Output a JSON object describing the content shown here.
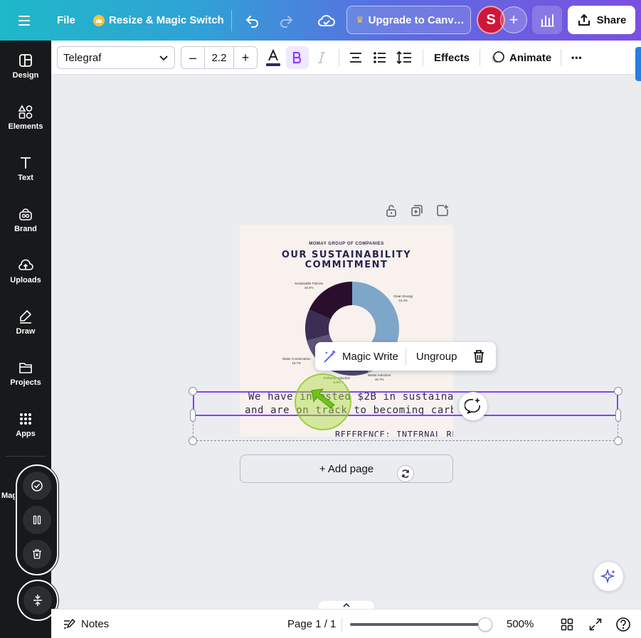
{
  "topbar": {
    "file_label": "File",
    "resize_label": "Resize & Magic Switch",
    "upgrade_label": "Upgrade to Canv…",
    "avatar_initial": "S",
    "share_label": "Share"
  },
  "sidebar": {
    "items": [
      {
        "label": "Design",
        "icon": "design-icon"
      },
      {
        "label": "Elements",
        "icon": "elements-icon"
      },
      {
        "label": "Text",
        "icon": "text-icon"
      },
      {
        "label": "Brand",
        "icon": "brand-icon"
      },
      {
        "label": "Uploads",
        "icon": "uploads-icon"
      },
      {
        "label": "Draw",
        "icon": "draw-icon"
      },
      {
        "label": "Projects",
        "icon": "projects-icon"
      },
      {
        "label": "Apps",
        "icon": "apps-icon"
      }
    ],
    "partial_label": "Mag"
  },
  "toolbar": {
    "font": "Telegraf",
    "font_size": "2.2",
    "minus": "–",
    "plus": "+",
    "effects_label": "Effects",
    "animate_label": "Animate",
    "more_label": "•••"
  },
  "design": {
    "company": "MOMAY GROUP OF COMPANIES",
    "title_line1": "OUR SUSTAINABILITY",
    "title_line2": "COMMITMENT",
    "body_line1": "We have invested $2B in sustainabil",
    "body_line2": "and are on track to becoming carbon",
    "reference": "REFERENCE: INTERNAL RE",
    "chart_data": {
      "type": "pie",
      "slices": [
        {
          "label": "Clean Energy",
          "value_label": "44.4%",
          "value": 44.4,
          "color": "#7ea6c9"
        },
        {
          "label": "Waste reduction",
          "value_label": "16.7%",
          "value": 16.7,
          "color": "#4c4a72"
        },
        {
          "label": "Pollution reduction",
          "value_label": "9.8%",
          "value": 9.8,
          "color": "#5e5478"
        },
        {
          "label": "Water Conservation",
          "value_label": "10.7%",
          "value": 10.7,
          "color": "#3d2d55"
        },
        {
          "label": "Sustainable Policies",
          "value_label": "18.4%",
          "value": 18.4,
          "color": "#2a0f2c"
        }
      ]
    }
  },
  "context_menu": {
    "magic_write": "Magic Write",
    "ungroup": "Ungroup"
  },
  "add_page_label": "+ Add page",
  "bottombar": {
    "notes_label": "Notes",
    "page_label": "Page 1 / 1",
    "zoom_label": "500%",
    "zoom_fraction": 0.95
  },
  "colors": {
    "accent": "#8b3dff",
    "sidebar_bg": "#18191b",
    "avatar_bg": "#d0163a"
  }
}
